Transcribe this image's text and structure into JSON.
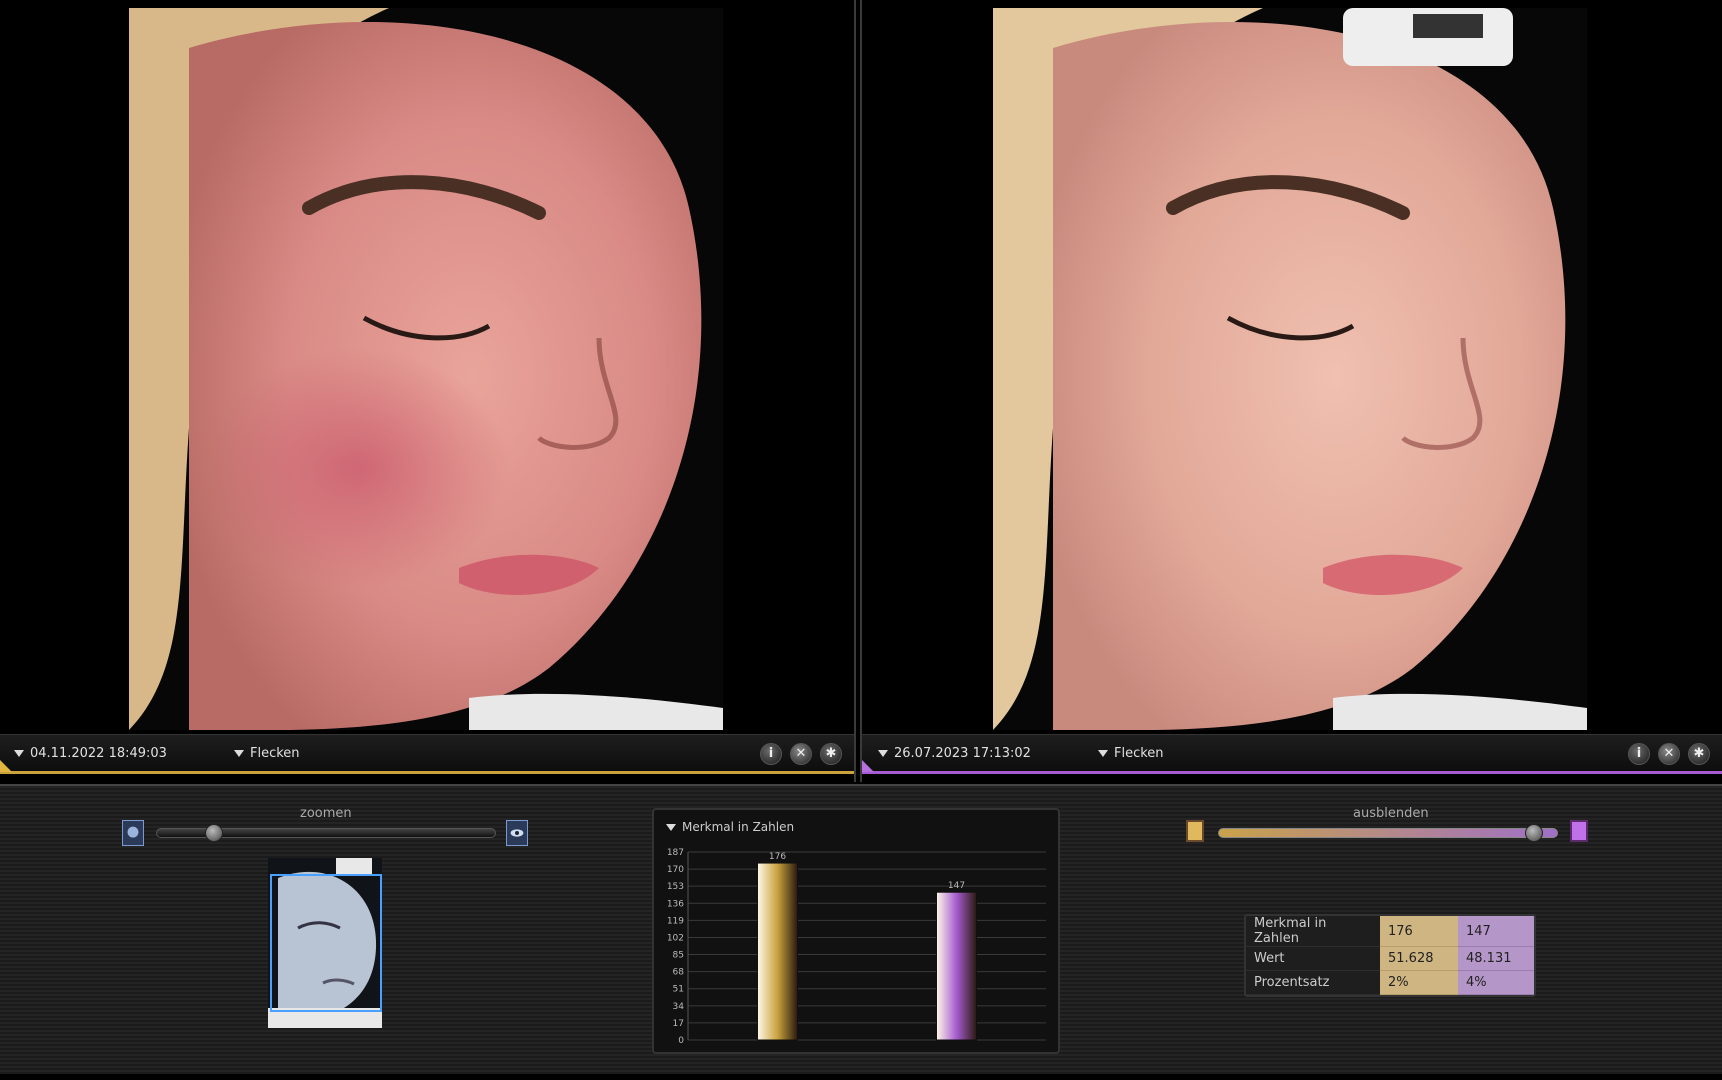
{
  "left_pane": {
    "date": "04.11.2022 18:49:03",
    "mode": "Flecken",
    "accent": "#caa23c"
  },
  "right_pane": {
    "date": "26.07.2023 17:13:02",
    "mode": "Flecken",
    "accent": "#a65cd0"
  },
  "pane_icons": {
    "info": "info-icon",
    "close": "close-icon",
    "settings": "gear-icon"
  },
  "zoom": {
    "label": "zoomen",
    "level": 0.15
  },
  "blend": {
    "label": "ausblenden",
    "level": 0.95
  },
  "chart_data": {
    "type": "bar",
    "title": "Merkmal in Zahlen",
    "categories": [
      "",
      ""
    ],
    "values": [
      176,
      147
    ],
    "value_labels": [
      "176",
      "147"
    ],
    "ylim": [
      0,
      187
    ],
    "yticks": [
      0,
      17,
      34,
      51,
      68,
      85,
      102,
      119,
      136,
      153,
      170,
      187
    ],
    "colors": [
      "#caa23c",
      "#a65cd0"
    ],
    "grid": true
  },
  "metrics_table": {
    "rows": [
      {
        "label": "Merkmal in Zahlen",
        "a": "176",
        "b": "147"
      },
      {
        "label": "Wert",
        "a": "51.628",
        "b": "48.131"
      },
      {
        "label": "Prozentsatz",
        "a": "2%",
        "b": "4%"
      }
    ]
  }
}
